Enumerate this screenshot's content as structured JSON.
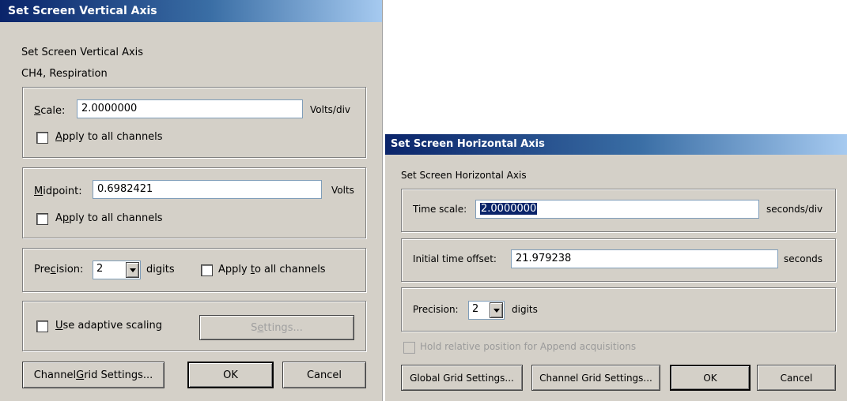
{
  "vertical": {
    "title": "Set Screen Vertical Axis",
    "heading": "Set Screen Vertical Axis",
    "channel": "CH4, Respiration",
    "scale": {
      "label_key": "S",
      "label_rest": "cale:",
      "value": "2.0000000",
      "unit": "Volts/div",
      "apply_key": "A",
      "apply_rest": "pply to all channels"
    },
    "midpoint": {
      "label_key": "M",
      "label_rest": "idpoint:",
      "value": "0.6982421",
      "unit": "Volts",
      "apply_pre": "A",
      "apply_key": "p",
      "apply_rest": "ply to all channels"
    },
    "precision": {
      "label_pre": "Pre",
      "label_key": "c",
      "label_rest": "ision:",
      "value": "2",
      "unit": "digits",
      "apply_pre": "Apply ",
      "apply_key": "t",
      "apply_rest": "o all channels"
    },
    "adaptive": {
      "label_key": "U",
      "label_rest": "se adaptive scaling",
      "settings_pre": "S",
      "settings_key": "e",
      "settings_rest": "ttings..."
    },
    "buttons": {
      "grid_pre": "Channel ",
      "grid_key": "G",
      "grid_rest": "rid Settings...",
      "ok": "OK",
      "cancel": "Cancel"
    }
  },
  "horizontal": {
    "title": "Set Screen Horizontal Axis",
    "heading": "Set Screen Horizontal Axis",
    "time_scale": {
      "label": "Time scale:",
      "value": "2.0000000",
      "unit": "seconds/div"
    },
    "offset": {
      "label": "Initial time offset:",
      "value": "21.979238",
      "unit": "seconds"
    },
    "precision": {
      "label": "Precision:",
      "value": "2",
      "unit": "digits"
    },
    "hold": "Hold relative position for Append acquisitions",
    "buttons": {
      "global_grid": "Global Grid Settings...",
      "channel_grid": "Channel Grid Settings...",
      "ok": "OK",
      "cancel": "Cancel"
    }
  }
}
